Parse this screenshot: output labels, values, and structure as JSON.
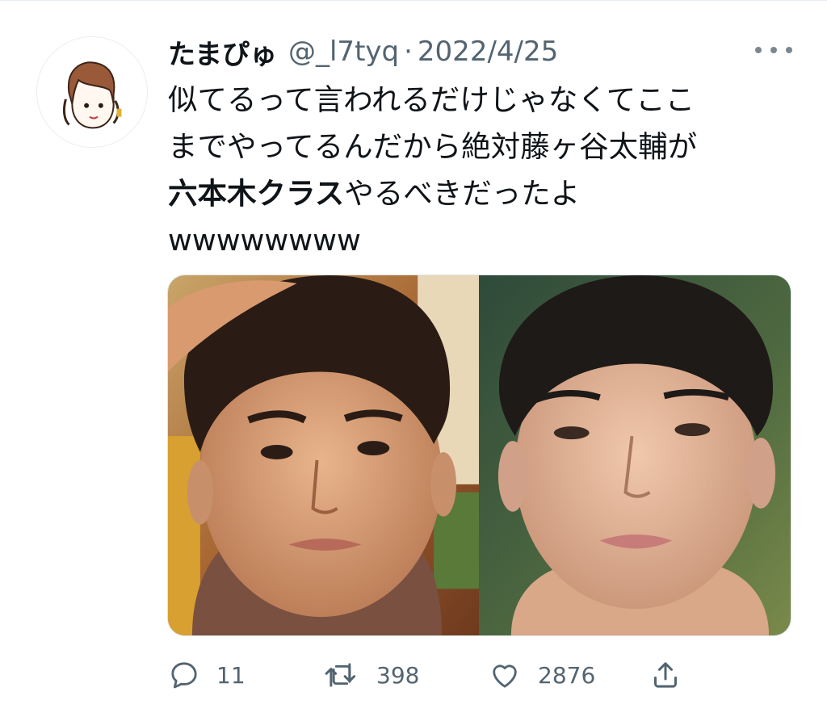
{
  "tweet": {
    "display_name": "たまぴゅ",
    "handle": "@_l7tyq",
    "separator": "·",
    "date": "2022/4/25",
    "text_line1": "似てるって言われるだけじゃなくてここ",
    "text_line2": "までやってるんだから絶対藤ヶ谷太輔が",
    "text_line3_bold": "六本木クラス",
    "text_line3_rest": "やるべきだったよ",
    "text_line4": "wwwwwwww"
  },
  "actions": {
    "reply_count": "11",
    "retweet_count": "398",
    "like_count": "2876"
  },
  "colors": {
    "text": "#0f1419",
    "secondary": "#536471",
    "border": "#e6ecf0"
  },
  "icons": {
    "more": "more-dots-icon",
    "reply": "reply-icon",
    "retweet": "retweet-icon",
    "like": "heart-icon",
    "share": "share-icon"
  }
}
